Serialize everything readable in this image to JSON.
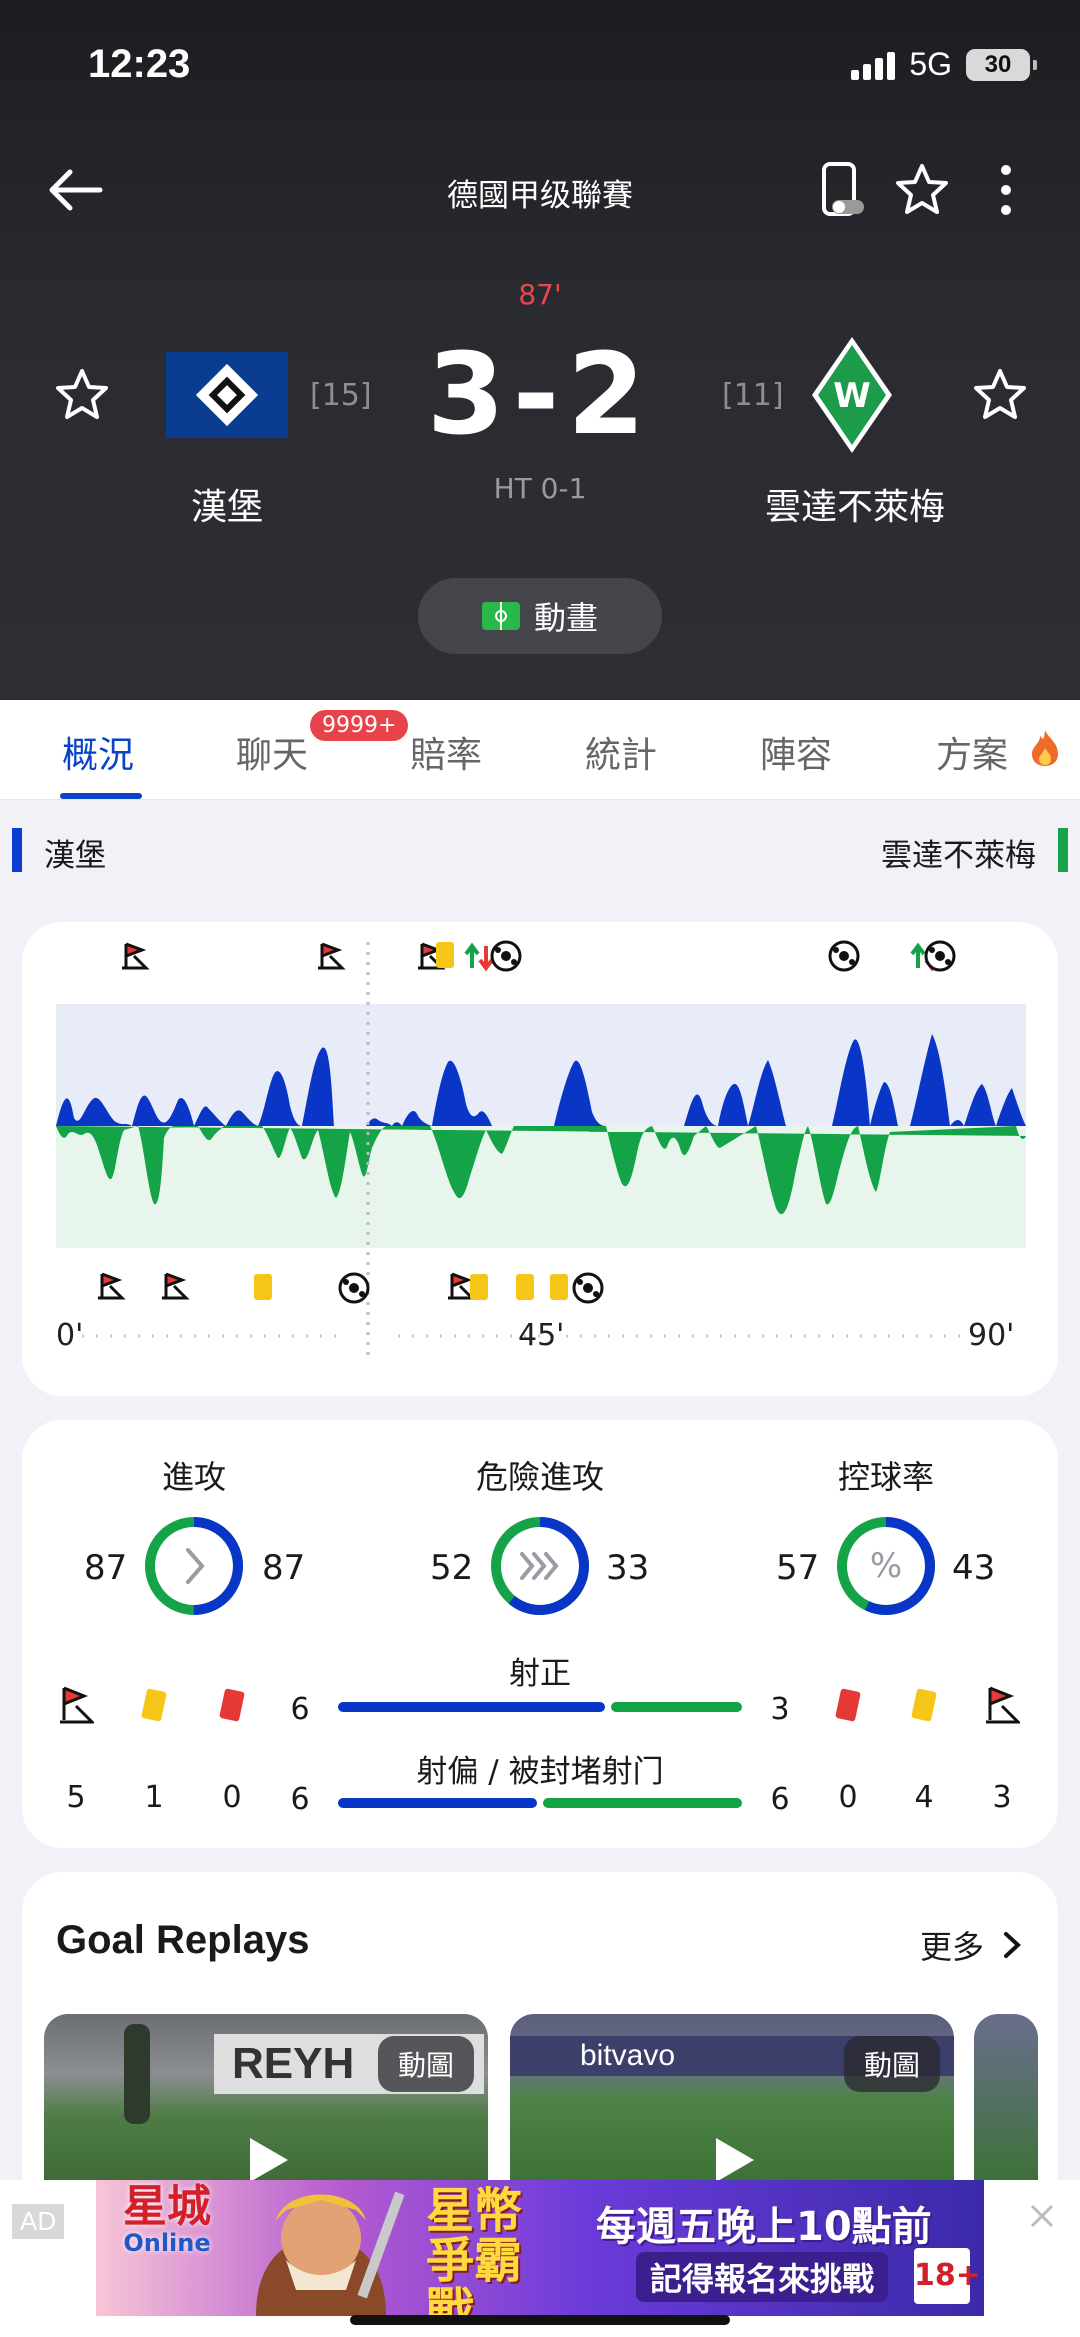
{
  "status_bar": {
    "time": "12:23",
    "network": "5G",
    "battery": "30"
  },
  "header": {
    "league": "德國甲级聯賽",
    "minute": "87'",
    "score": "3-2",
    "halftime": "HT 0-1",
    "home": {
      "name": "漢堡",
      "rank": "[15]"
    },
    "away": {
      "name": "雲達不萊梅",
      "rank": "[11]"
    },
    "animation_label": "動畫"
  },
  "tabs": [
    {
      "label": "概況",
      "active": true
    },
    {
      "label": "聊天",
      "badge": "9999+"
    },
    {
      "label": "賠率"
    },
    {
      "label": "統計"
    },
    {
      "label": "陣容"
    },
    {
      "label": "方案"
    }
  ],
  "team_bar": {
    "home": "漢堡",
    "away": "雲達不萊梅",
    "home_color": "#0a3dd0",
    "away_color": "#18a34a"
  },
  "momentum": {
    "axis": {
      "start": "0'",
      "mid": "45'",
      "end": "90'"
    },
    "home_events": [
      "corner",
      "corner",
      "corner",
      "yellow-card",
      "substitution",
      "goal",
      "goal",
      "substitution",
      "goal"
    ],
    "away_events": [
      "corner",
      "corner",
      "yellow-card",
      "goal",
      "corner",
      "yellow-card",
      "yellow-card",
      "yellow-card",
      "goal"
    ]
  },
  "stats": {
    "attack": {
      "label": "進攻",
      "home": "87",
      "away": "87",
      "home_share": 0.5
    },
    "dangerous_attack": {
      "label": "危險進攻",
      "home": "52",
      "away": "33",
      "home_share": 0.61
    },
    "possession": {
      "label": "控球率",
      "home": "57",
      "away": "43",
      "home_share": 0.57
    },
    "home_counts": {
      "corners": "5",
      "yellow": "1",
      "red": "0"
    },
    "away_counts": {
      "red": "0",
      "yellow": "4",
      "corners": "3"
    },
    "shots_on_target": {
      "label": "射正",
      "home": "6",
      "away": "3",
      "home_share": 0.67
    },
    "shots_off": {
      "label": "射偏 / 被封堵射门",
      "home": "6",
      "away": "6",
      "home_share": 0.5
    }
  },
  "replays": {
    "title": "Goal Replays",
    "more": "更多",
    "items": [
      {
        "tag": "動圖",
        "sign": "REYH"
      },
      {
        "tag": "動圖",
        "sign": "bitvavo"
      }
    ]
  },
  "ad": {
    "tag": "AD",
    "logo": "星城",
    "logo_sub": "Online",
    "brand": "星幣爭霸戰",
    "line1": "每週五晚上10點前",
    "line2": "記得報名來挑戰",
    "age": "18+"
  }
}
